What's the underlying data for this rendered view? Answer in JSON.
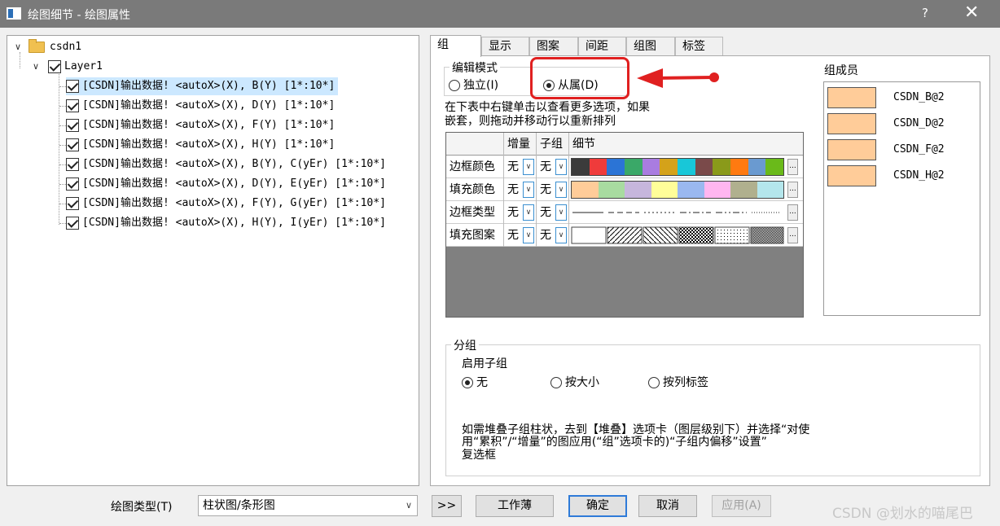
{
  "window": {
    "title": "绘图细节 - 绘图属性",
    "help": "?",
    "close": "✕"
  },
  "tree": {
    "root": "csdn1",
    "layer": "Layer1",
    "items": [
      "[CSDN]输出数据! <autoX>(X), B(Y) [1*:10*]",
      "[CSDN]输出数据! <autoX>(X), D(Y) [1*:10*]",
      "[CSDN]输出数据! <autoX>(X), F(Y) [1*:10*]",
      "[CSDN]输出数据! <autoX>(X), H(Y) [1*:10*]",
      "[CSDN]输出数据! <autoX>(X), B(Y), C(yEr) [1*:10*]",
      "[CSDN]输出数据! <autoX>(X), D(Y), E(yEr) [1*:10*]",
      "[CSDN]输出数据! <autoX>(X), F(Y), G(yEr) [1*:10*]",
      "[CSDN]输出数据! <autoX>(X), H(Y), I(yEr) [1*:10*]"
    ]
  },
  "tabs": [
    "组",
    "显示",
    "图案",
    "间距",
    "组图",
    "标签"
  ],
  "edit_mode": {
    "label": "编辑模式",
    "independent": "独立(I)",
    "dependent": "从属(D)"
  },
  "hint": [
    "在下表中右键单击以查看更多选项，如果",
    "嵌套，则拖动并移动行以重新排列"
  ],
  "grid": {
    "headers": [
      "增量",
      "子组",
      "细节"
    ],
    "rows": [
      {
        "label": "边框颜色",
        "inc": "无",
        "sub": "无",
        "kind": "colors",
        "colors": [
          "#3b3b3b",
          "#ef3b3b",
          "#2b74d6",
          "#3aa868",
          "#a97ce0",
          "#d4a21a",
          "#18c7d8",
          "#7a4a4a",
          "#8a9a1a",
          "#ff7a10",
          "#6a9ad0",
          "#6aba1a"
        ]
      },
      {
        "label": "填充颜色",
        "inc": "无",
        "sub": "无",
        "kind": "colors",
        "colors": [
          "#ffcc99",
          "#a8dba0",
          "#c6b6dc",
          "#fffe99",
          "#9ab8f0",
          "#ffb6f0",
          "#b0b08e",
          "#b4e6ec"
        ]
      },
      {
        "label": "边框类型",
        "inc": "无",
        "sub": "无",
        "kind": "lines"
      },
      {
        "label": "填充图案",
        "inc": "无",
        "sub": "无",
        "kind": "patterns"
      }
    ]
  },
  "members": {
    "label": "组成员",
    "items": [
      "CSDN_B@2",
      "CSDN_D@2",
      "CSDN_F@2",
      "CSDN_H@2"
    ],
    "color": "#ffcc99"
  },
  "grouping": {
    "label": "分组",
    "enable": "启用子组",
    "options": [
      "无",
      "按大小",
      "按列标签"
    ],
    "note": [
      "如需堆叠子组柱状，去到【堆叠】选项卡（图层级别下）并选择“对使",
      "用“累积”/“增量”的图应用(“组”选项卡的)“子组内偏移”设置”",
      "复选框"
    ]
  },
  "bottom": {
    "plot_type_label": "绘图类型(T)",
    "plot_type_value": "柱状图/条形图",
    "more": ">>",
    "workbook": "工作薄",
    "ok": "确定",
    "cancel": "取消",
    "apply": "应用(A)"
  },
  "watermark": "CSDN @划水的喵尾巴",
  "accent": "#e02020"
}
